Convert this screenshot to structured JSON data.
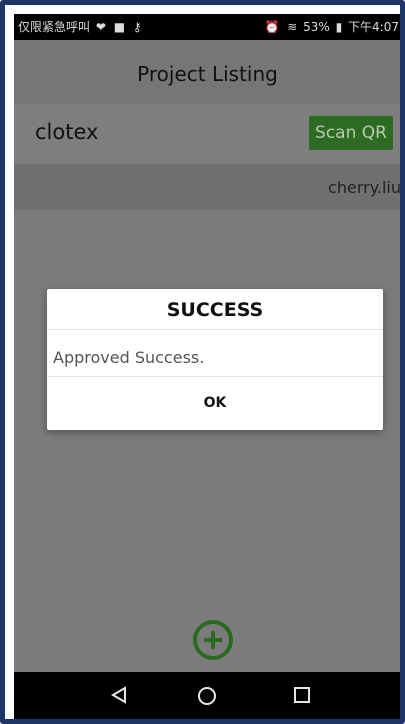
{
  "status_bar": {
    "left_text": "仅限紧急呼叫",
    "battery": "53%",
    "time": "下午4:07"
  },
  "header": {
    "title": "Project Listing"
  },
  "project": {
    "name": "clotex",
    "scan_button": "Scan QR",
    "user": "cherry.liu"
  },
  "dialog": {
    "title": "SUCCESS",
    "message": "Approved Success.",
    "ok_label": "OK"
  },
  "colors": {
    "accent": "#2d6a22",
    "dialog_bg": "#ffffff",
    "overlay": "#7b7b7b"
  },
  "icons": {
    "add": "plus-circle-icon",
    "nav_back": "back-triangle-icon",
    "nav_home": "home-circle-icon",
    "nav_recent": "recent-square-icon"
  }
}
